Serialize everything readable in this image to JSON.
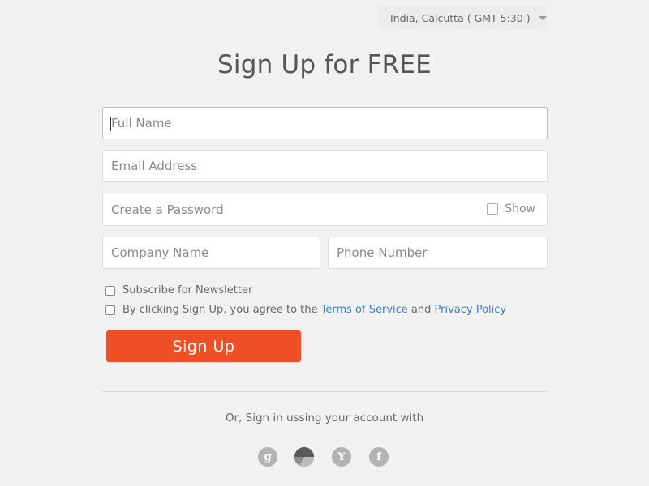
{
  "timezone": {
    "label": "India, Calcutta ( GMT 5:30 )"
  },
  "title": "Sign Up for FREE",
  "fields": {
    "full_name": {
      "placeholder": "Full Name",
      "value": ""
    },
    "email": {
      "placeholder": "Email Address",
      "value": ""
    },
    "password": {
      "placeholder": "Create a Password",
      "value": "",
      "show_label": "Show"
    },
    "company": {
      "placeholder": "Company Name",
      "value": ""
    },
    "phone": {
      "placeholder": "Phone Number",
      "value": ""
    }
  },
  "checkboxes": {
    "newsletter": {
      "label": "Subscribe for Newsletter",
      "checked": false
    },
    "terms": {
      "prefix": "By clicking Sign Up, you agree to the",
      "terms_link": "Terms of Service",
      "and": "and",
      "privacy_link": "Privacy Policy",
      "checked": false
    }
  },
  "signup_button": "Sign Up",
  "alt_signin": "Or, Sign in ussing your account with",
  "social": [
    {
      "icon": "google-icon",
      "glyph": "g"
    },
    {
      "icon": "alt-service-icon",
      "glyph": ""
    },
    {
      "icon": "yahoo-icon",
      "glyph": "Y"
    },
    {
      "icon": "facebook-icon",
      "glyph": "f"
    }
  ],
  "colors": {
    "accent": "#ee4f24",
    "link": "#3a7fc4",
    "background": "#f1f1f1"
  }
}
